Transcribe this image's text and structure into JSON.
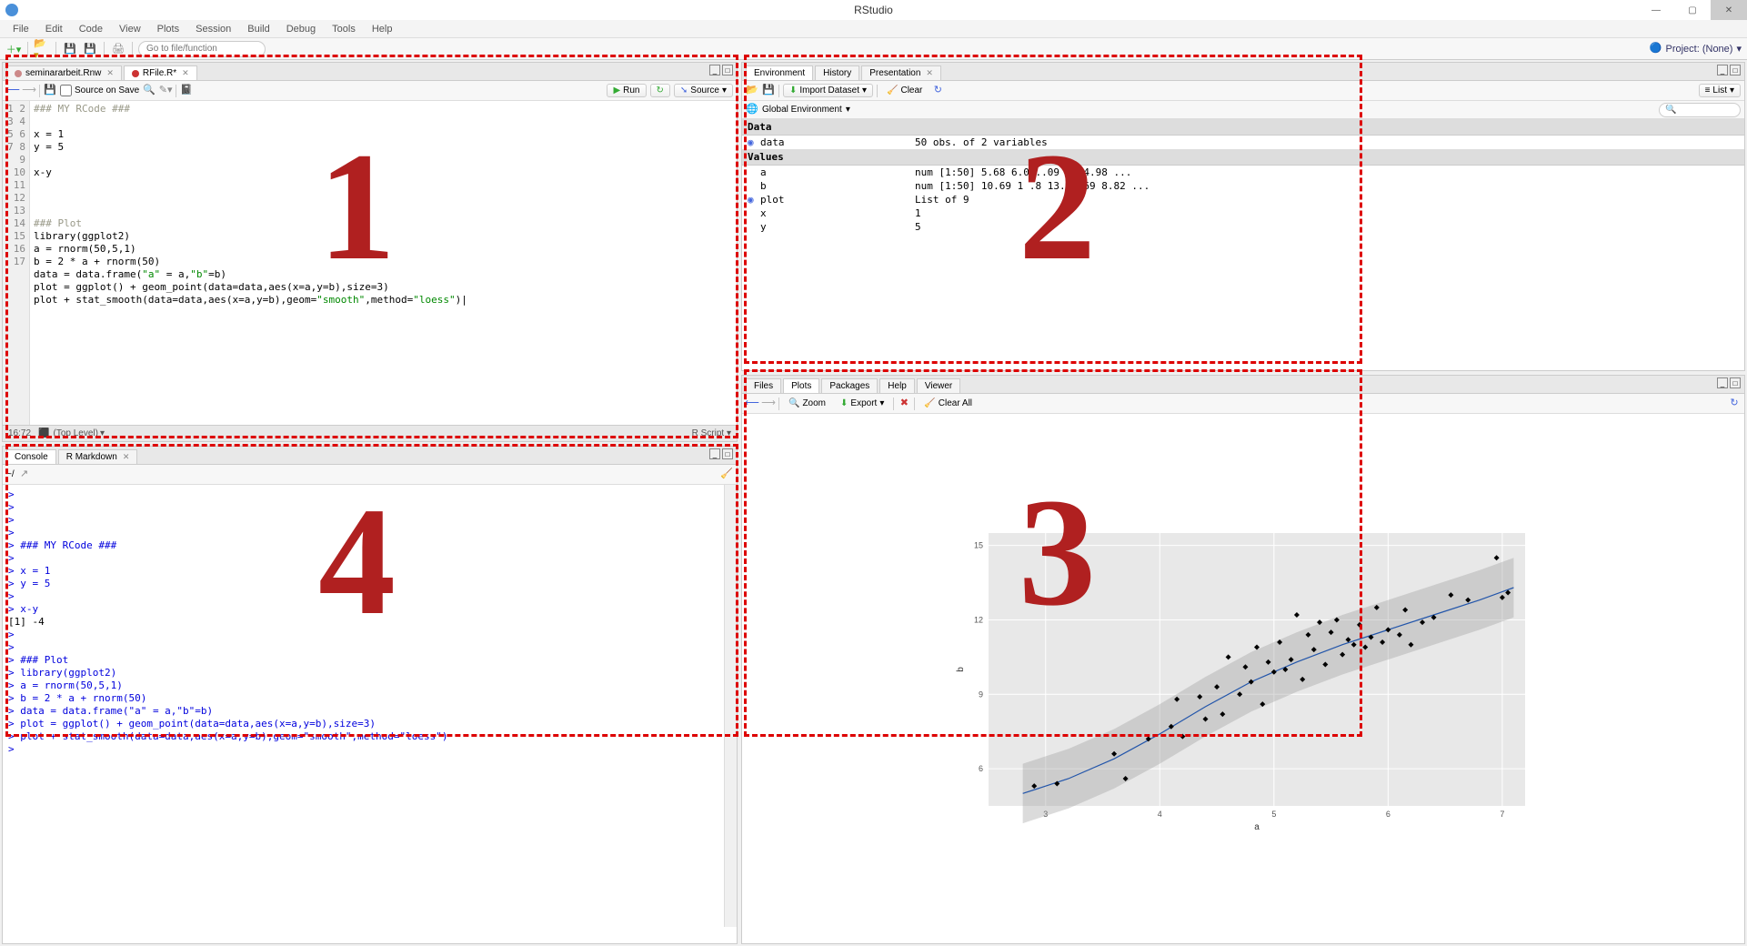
{
  "title": "RStudio",
  "menu": [
    "File",
    "Edit",
    "Code",
    "View",
    "Plots",
    "Session",
    "Build",
    "Debug",
    "Tools",
    "Help"
  ],
  "toolbar": {
    "goto_placeholder": "Go to file/function",
    "project_label": "Project: (None)"
  },
  "editor": {
    "tabs": [
      {
        "label": "seminararbeit.Rnw",
        "active": false,
        "color": "#c88"
      },
      {
        "label": "RFile.R*",
        "active": true,
        "color": "#c33"
      }
    ],
    "source_on_save": "Source on Save",
    "run_label": "Run",
    "source_label": "Source",
    "status_pos": "16:72",
    "status_scope": "(Top Level)",
    "status_lang": "R Script",
    "lines": [
      "",
      "",
      "x = 1",
      "y = 5",
      "",
      "x-y",
      "",
      "",
      "",
      "### Plot",
      "library(ggplot2)",
      "a = rnorm(50,5,1)",
      "b = 2 * a + rnorm(50)",
      "data = data.frame(\"a\" = a,\"b\"=b)",
      "plot = ggplot() + geom_point(data=data,aes(x=a,y=b),size=3)",
      "plot + stat_smooth(data=data,aes(x=a,y=b),geom=\"smooth\",method=\"loess\")|",
      ""
    ],
    "line1": "### MY RCode ###"
  },
  "console": {
    "tabs": [
      {
        "label": "Console",
        "active": true
      },
      {
        "label": "R Markdown",
        "active": false
      }
    ],
    "path": "~/",
    "lines": [
      {
        "t": "p",
        "v": ">"
      },
      {
        "t": "p",
        "v": ">"
      },
      {
        "t": "p",
        "v": ">"
      },
      {
        "t": "p",
        "v": ">"
      },
      {
        "t": "p",
        "v": "> ### MY RCode ###"
      },
      {
        "t": "p",
        "v": ">"
      },
      {
        "t": "p",
        "v": "> x = 1"
      },
      {
        "t": "p",
        "v": "> y = 5"
      },
      {
        "t": "p",
        "v": ">"
      },
      {
        "t": "p",
        "v": "> x-y"
      },
      {
        "t": "o",
        "v": "[1] -4"
      },
      {
        "t": "p",
        "v": ">"
      },
      {
        "t": "p",
        "v": ">"
      },
      {
        "t": "p",
        "v": "> ### Plot"
      },
      {
        "t": "p",
        "v": "> library(ggplot2)"
      },
      {
        "t": "p",
        "v": "> a = rnorm(50,5,1)"
      },
      {
        "t": "p",
        "v": "> b = 2 * a + rnorm(50)"
      },
      {
        "t": "p",
        "v": "> data = data.frame(\"a\" = a,\"b\"=b)"
      },
      {
        "t": "p",
        "v": "> plot = ggplot() + geom_point(data=data,aes(x=a,y=b),size=3)"
      },
      {
        "t": "p",
        "v": "> plot + stat_smooth(data=data,aes(x=a,y=b),geom=\"smooth\",method=\"loess\")"
      },
      {
        "t": "p",
        "v": "> "
      }
    ]
  },
  "env": {
    "tabs": [
      {
        "label": "Environment",
        "active": true
      },
      {
        "label": "History",
        "active": false
      },
      {
        "label": "Presentation",
        "active": false
      }
    ],
    "import_label": "Import Dataset",
    "clear_label": "Clear",
    "list_label": "List",
    "scope_label": "Global Environment",
    "sections": [
      {
        "title": "Data",
        "rows": [
          {
            "exp": true,
            "name": "data",
            "val": "50 obs. of 2 variables"
          }
        ]
      },
      {
        "title": "Values",
        "rows": [
          {
            "exp": false,
            "name": "a",
            "val": "num [1:50] 5.68 6.0  ..09 5.  4.98 ..."
          },
          {
            "exp": false,
            "name": "b",
            "val": "num [1:50] 10.69 1  .8 13.28   69 8.82 ..."
          },
          {
            "exp": true,
            "name": "plot",
            "val": "List of 9"
          },
          {
            "exp": false,
            "name": "x",
            "val": "1"
          },
          {
            "exp": false,
            "name": "y",
            "val": "5"
          }
        ]
      }
    ]
  },
  "plots": {
    "tabs": [
      {
        "label": "Files"
      },
      {
        "label": "Plots",
        "active": true
      },
      {
        "label": "Packages"
      },
      {
        "label": "Help"
      },
      {
        "label": "Viewer"
      }
    ],
    "zoom_label": "Zoom",
    "export_label": "Export",
    "clearall_label": "Clear All"
  },
  "chart_data": {
    "type": "scatter",
    "xlabel": "a",
    "ylabel": "b",
    "xlim": [
      2.5,
      7.2
    ],
    "ylim": [
      4.5,
      15.5
    ],
    "xticks": [
      3,
      4,
      5,
      6,
      7
    ],
    "yticks": [
      6,
      9,
      12,
      15
    ],
    "points": [
      [
        2.9,
        5.3
      ],
      [
        3.1,
        5.4
      ],
      [
        3.6,
        6.6
      ],
      [
        3.7,
        5.6
      ],
      [
        3.9,
        7.2
      ],
      [
        4.1,
        7.7
      ],
      [
        4.15,
        8.8
      ],
      [
        4.2,
        7.3
      ],
      [
        4.35,
        8.9
      ],
      [
        4.4,
        8.0
      ],
      [
        4.5,
        9.3
      ],
      [
        4.55,
        8.2
      ],
      [
        4.6,
        10.5
      ],
      [
        4.7,
        9.0
      ],
      [
        4.75,
        10.1
      ],
      [
        4.8,
        9.5
      ],
      [
        4.85,
        10.9
      ],
      [
        4.9,
        8.6
      ],
      [
        4.95,
        10.3
      ],
      [
        5.0,
        9.9
      ],
      [
        5.05,
        11.1
      ],
      [
        5.1,
        10.0
      ],
      [
        5.15,
        10.4
      ],
      [
        5.2,
        12.2
      ],
      [
        5.25,
        9.6
      ],
      [
        5.3,
        11.4
      ],
      [
        5.35,
        10.8
      ],
      [
        5.4,
        11.9
      ],
      [
        5.45,
        10.2
      ],
      [
        5.5,
        11.5
      ],
      [
        5.55,
        12.0
      ],
      [
        5.6,
        10.6
      ],
      [
        5.65,
        11.2
      ],
      [
        5.7,
        11.0
      ],
      [
        5.75,
        11.8
      ],
      [
        5.8,
        10.9
      ],
      [
        5.85,
        11.3
      ],
      [
        5.9,
        12.5
      ],
      [
        5.95,
        11.1
      ],
      [
        6.0,
        11.6
      ],
      [
        6.1,
        11.4
      ],
      [
        6.15,
        12.4
      ],
      [
        6.2,
        11.0
      ],
      [
        6.3,
        11.9
      ],
      [
        6.4,
        12.1
      ],
      [
        6.55,
        13.0
      ],
      [
        6.7,
        12.8
      ],
      [
        6.95,
        14.5
      ],
      [
        7.0,
        12.9
      ],
      [
        7.05,
        13.1
      ]
    ],
    "smooth": [
      [
        2.8,
        5.0
      ],
      [
        3.2,
        5.6
      ],
      [
        3.6,
        6.4
      ],
      [
        4.0,
        7.4
      ],
      [
        4.4,
        8.5
      ],
      [
        4.8,
        9.5
      ],
      [
        5.2,
        10.3
      ],
      [
        5.6,
        11.0
      ],
      [
        6.0,
        11.6
      ],
      [
        6.4,
        12.2
      ],
      [
        6.8,
        12.8
      ],
      [
        7.1,
        13.3
      ]
    ]
  },
  "overlay": {
    "n1": "1",
    "n2": "2",
    "n3": "3",
    "n4": "4"
  }
}
